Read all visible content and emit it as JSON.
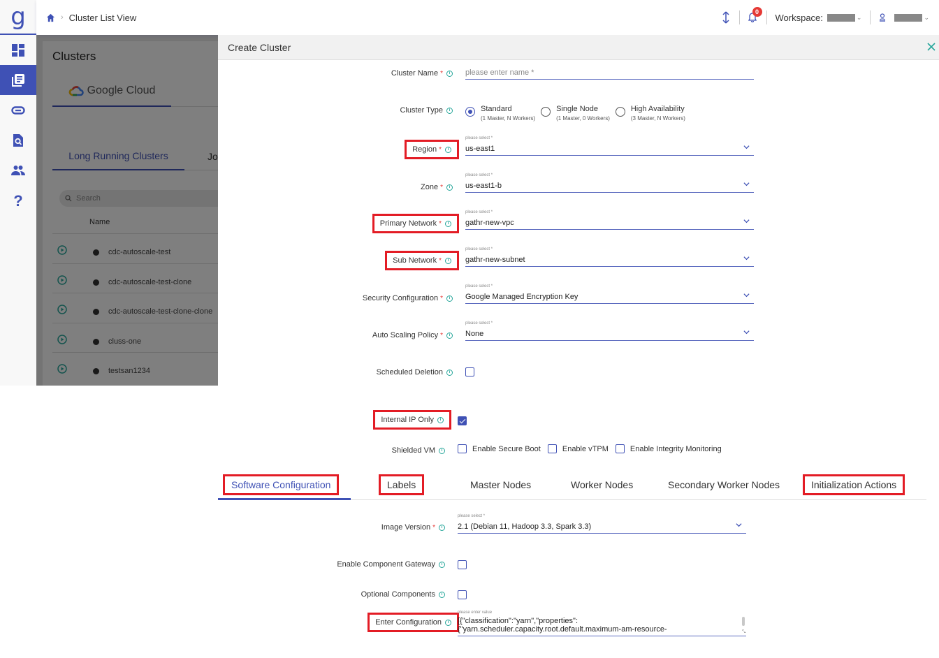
{
  "app": {
    "logo": "g",
    "breadcrumb": {
      "home_icon": "home-icon",
      "current": "Cluster List View"
    },
    "topbar": {
      "workspace_label": "Workspace:",
      "notification_count": "0"
    },
    "sidebar": [
      {
        "icon": "dashboard-icon",
        "active": false
      },
      {
        "icon": "clusters-icon",
        "active": true
      },
      {
        "icon": "link-icon",
        "active": false
      },
      {
        "icon": "file-search-icon",
        "active": false
      },
      {
        "icon": "users-icon",
        "active": false
      },
      {
        "icon": "help-icon",
        "active": false
      }
    ]
  },
  "clusters_page": {
    "title": "Clusters",
    "provider_tab": "Google Cloud",
    "tabs": [
      "Long Running Clusters",
      "Jo"
    ],
    "search_placeholder": "Search",
    "column_name": "Name",
    "rows": [
      {
        "name": "cdc-autoscale-test"
      },
      {
        "name": "cdc-autoscale-test-clone"
      },
      {
        "name": "cdc-autoscale-test-clone-clone"
      },
      {
        "name": "cluss-one"
      },
      {
        "name": "testsan1234"
      }
    ]
  },
  "create_cluster": {
    "title": "Create Cluster",
    "cluster_name": {
      "label": "Cluster Name",
      "placeholder": "please enter name *"
    },
    "cluster_type": {
      "label": "Cluster Type",
      "options": [
        {
          "title": "Standard",
          "sub": "(1 Master, N Workers)",
          "selected": true
        },
        {
          "title": "Single Node",
          "sub": "(1 Master, 0 Workers)",
          "selected": false
        },
        {
          "title": "High Availability",
          "sub": "(3 Master, N Workers)",
          "selected": false
        }
      ]
    },
    "select_hint": "please select *",
    "region": {
      "label": "Region",
      "value": "us-east1"
    },
    "zone": {
      "label": "Zone",
      "value": "us-east1-b"
    },
    "primary_network": {
      "label": "Primary Network",
      "value": "gathr-new-vpc"
    },
    "sub_network": {
      "label": "Sub Network",
      "value": "gathr-new-subnet"
    },
    "security_configuration": {
      "label": "Security Configuration",
      "value": "Google Managed Encryption Key"
    },
    "auto_scaling_policy": {
      "label": "Auto Scaling Policy",
      "value": "None"
    },
    "scheduled_deletion": {
      "label": "Scheduled Deletion",
      "checked": false
    },
    "internal_ip_only": {
      "label": "Internal IP Only",
      "checked": true
    },
    "shielded_vm": {
      "label": "Shielded VM",
      "options": [
        {
          "label": "Enable Secure Boot",
          "checked": false
        },
        {
          "label": "Enable vTPM",
          "checked": false
        },
        {
          "label": "Enable Integrity Monitoring",
          "checked": false
        }
      ]
    },
    "tabs": [
      {
        "label": "Software Configuration",
        "active": true
      },
      {
        "label": "Labels",
        "active": false
      },
      {
        "label": "Master Nodes",
        "active": false
      },
      {
        "label": "Worker Nodes",
        "active": false
      },
      {
        "label": "Secondary Worker Nodes",
        "active": false
      },
      {
        "label": "Initialization Actions",
        "active": false
      }
    ],
    "image_version": {
      "label": "Image Version",
      "value": "2.1 (Debian 11, Hadoop 3.3, Spark 3.3)"
    },
    "enable_component_gateway": {
      "label": "Enable Component Gateway",
      "checked": false
    },
    "optional_components": {
      "label": "Optional Components",
      "checked": false
    },
    "enter_configuration": {
      "label": "Enter Configuration",
      "hint": "please enter value",
      "value": "[{\"classification\":\"yarn\",\"properties\":{\"yarn.scheduler.capacity.root.default.maximum-am-resource-"
    },
    "highlight_color": "#e31c25",
    "accent_color": "#3f51b5"
  }
}
